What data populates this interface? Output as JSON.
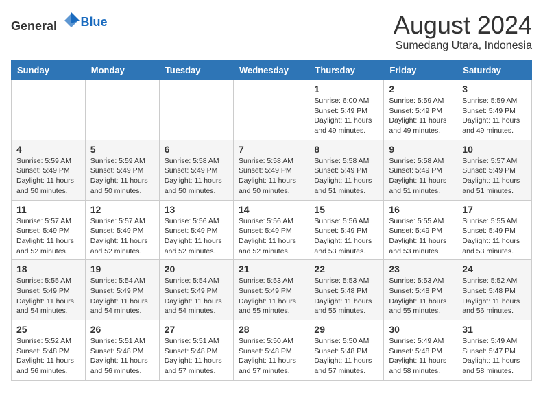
{
  "header": {
    "logo_general": "General",
    "logo_blue": "Blue",
    "month_title": "August 2024",
    "location": "Sumedang Utara, Indonesia"
  },
  "days_of_week": [
    "Sunday",
    "Monday",
    "Tuesday",
    "Wednesday",
    "Thursday",
    "Friday",
    "Saturday"
  ],
  "weeks": [
    [
      {
        "day": "",
        "info": ""
      },
      {
        "day": "",
        "info": ""
      },
      {
        "day": "",
        "info": ""
      },
      {
        "day": "",
        "info": ""
      },
      {
        "day": "1",
        "info": "Sunrise: 6:00 AM\nSunset: 5:49 PM\nDaylight: 11 hours and 49 minutes."
      },
      {
        "day": "2",
        "info": "Sunrise: 5:59 AM\nSunset: 5:49 PM\nDaylight: 11 hours and 49 minutes."
      },
      {
        "day": "3",
        "info": "Sunrise: 5:59 AM\nSunset: 5:49 PM\nDaylight: 11 hours and 49 minutes."
      }
    ],
    [
      {
        "day": "4",
        "info": "Sunrise: 5:59 AM\nSunset: 5:49 PM\nDaylight: 11 hours and 50 minutes."
      },
      {
        "day": "5",
        "info": "Sunrise: 5:59 AM\nSunset: 5:49 PM\nDaylight: 11 hours and 50 minutes."
      },
      {
        "day": "6",
        "info": "Sunrise: 5:58 AM\nSunset: 5:49 PM\nDaylight: 11 hours and 50 minutes."
      },
      {
        "day": "7",
        "info": "Sunrise: 5:58 AM\nSunset: 5:49 PM\nDaylight: 11 hours and 50 minutes."
      },
      {
        "day": "8",
        "info": "Sunrise: 5:58 AM\nSunset: 5:49 PM\nDaylight: 11 hours and 51 minutes."
      },
      {
        "day": "9",
        "info": "Sunrise: 5:58 AM\nSunset: 5:49 PM\nDaylight: 11 hours and 51 minutes."
      },
      {
        "day": "10",
        "info": "Sunrise: 5:57 AM\nSunset: 5:49 PM\nDaylight: 11 hours and 51 minutes."
      }
    ],
    [
      {
        "day": "11",
        "info": "Sunrise: 5:57 AM\nSunset: 5:49 PM\nDaylight: 11 hours and 52 minutes."
      },
      {
        "day": "12",
        "info": "Sunrise: 5:57 AM\nSunset: 5:49 PM\nDaylight: 11 hours and 52 minutes."
      },
      {
        "day": "13",
        "info": "Sunrise: 5:56 AM\nSunset: 5:49 PM\nDaylight: 11 hours and 52 minutes."
      },
      {
        "day": "14",
        "info": "Sunrise: 5:56 AM\nSunset: 5:49 PM\nDaylight: 11 hours and 52 minutes."
      },
      {
        "day": "15",
        "info": "Sunrise: 5:56 AM\nSunset: 5:49 PM\nDaylight: 11 hours and 53 minutes."
      },
      {
        "day": "16",
        "info": "Sunrise: 5:55 AM\nSunset: 5:49 PM\nDaylight: 11 hours and 53 minutes."
      },
      {
        "day": "17",
        "info": "Sunrise: 5:55 AM\nSunset: 5:49 PM\nDaylight: 11 hours and 53 minutes."
      }
    ],
    [
      {
        "day": "18",
        "info": "Sunrise: 5:55 AM\nSunset: 5:49 PM\nDaylight: 11 hours and 54 minutes."
      },
      {
        "day": "19",
        "info": "Sunrise: 5:54 AM\nSunset: 5:49 PM\nDaylight: 11 hours and 54 minutes."
      },
      {
        "day": "20",
        "info": "Sunrise: 5:54 AM\nSunset: 5:49 PM\nDaylight: 11 hours and 54 minutes."
      },
      {
        "day": "21",
        "info": "Sunrise: 5:53 AM\nSunset: 5:49 PM\nDaylight: 11 hours and 55 minutes."
      },
      {
        "day": "22",
        "info": "Sunrise: 5:53 AM\nSunset: 5:48 PM\nDaylight: 11 hours and 55 minutes."
      },
      {
        "day": "23",
        "info": "Sunrise: 5:53 AM\nSunset: 5:48 PM\nDaylight: 11 hours and 55 minutes."
      },
      {
        "day": "24",
        "info": "Sunrise: 5:52 AM\nSunset: 5:48 PM\nDaylight: 11 hours and 56 minutes."
      }
    ],
    [
      {
        "day": "25",
        "info": "Sunrise: 5:52 AM\nSunset: 5:48 PM\nDaylight: 11 hours and 56 minutes."
      },
      {
        "day": "26",
        "info": "Sunrise: 5:51 AM\nSunset: 5:48 PM\nDaylight: 11 hours and 56 minutes."
      },
      {
        "day": "27",
        "info": "Sunrise: 5:51 AM\nSunset: 5:48 PM\nDaylight: 11 hours and 57 minutes."
      },
      {
        "day": "28",
        "info": "Sunrise: 5:50 AM\nSunset: 5:48 PM\nDaylight: 11 hours and 57 minutes."
      },
      {
        "day": "29",
        "info": "Sunrise: 5:50 AM\nSunset: 5:48 PM\nDaylight: 11 hours and 57 minutes."
      },
      {
        "day": "30",
        "info": "Sunrise: 5:49 AM\nSunset: 5:48 PM\nDaylight: 11 hours and 58 minutes."
      },
      {
        "day": "31",
        "info": "Sunrise: 5:49 AM\nSunset: 5:47 PM\nDaylight: 11 hours and 58 minutes."
      }
    ]
  ]
}
